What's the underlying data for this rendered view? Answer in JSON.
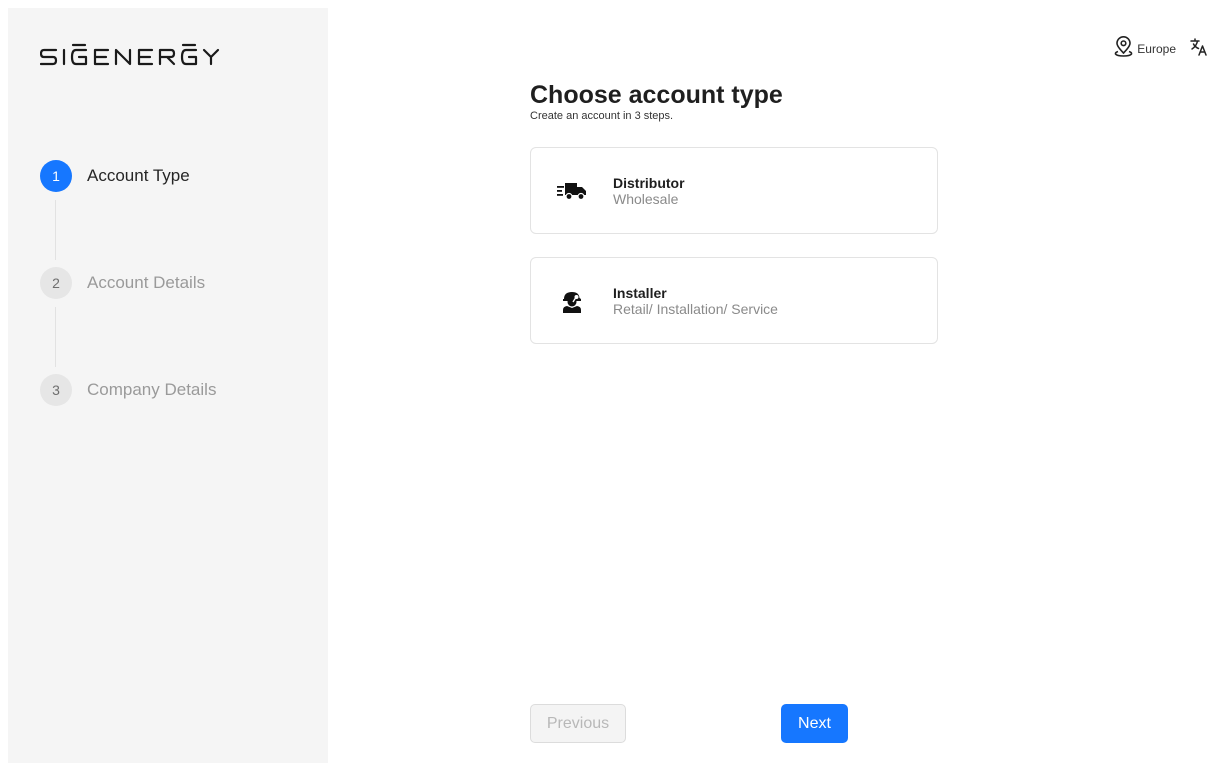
{
  "brand": {
    "logo_text": "SIGENERGY",
    "accent_color": "#1677ff"
  },
  "header": {
    "region_label": "Europe",
    "region_icon": "location-pin-icon",
    "language_icon": "translate-icon"
  },
  "sidebar": {
    "steps": [
      {
        "number": "1",
        "label": "Account Type",
        "active": true
      },
      {
        "number": "2",
        "label": "Account Details",
        "active": false
      },
      {
        "number": "3",
        "label": "Company Details",
        "active": false
      }
    ]
  },
  "main": {
    "title": "Choose account type",
    "subtitle": "Create an account in 3 steps.",
    "options": [
      {
        "icon": "delivery-truck-icon",
        "title": "Distributor",
        "subtitle": "Wholesale"
      },
      {
        "icon": "installer-worker-icon",
        "title": "Installer",
        "subtitle": "Retail/ Installation/ Service"
      }
    ]
  },
  "footer": {
    "previous_label": "Previous",
    "next_label": "Next"
  }
}
